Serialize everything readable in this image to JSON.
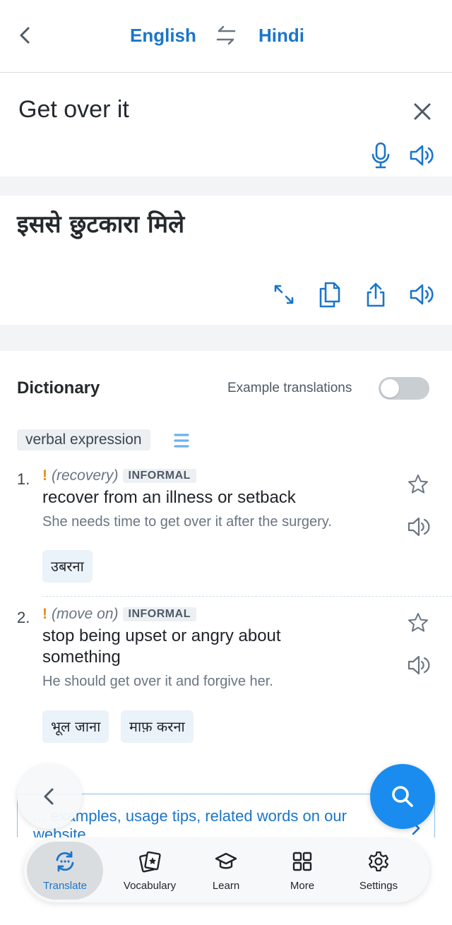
{
  "header": {
    "source_lang": "English",
    "target_lang": "Hindi",
    "icons": [
      "chevron-left-icon",
      "swap-icon"
    ]
  },
  "input": {
    "text": "Get over it",
    "icons": [
      "close-icon",
      "microphone-icon",
      "speaker-icon"
    ]
  },
  "output": {
    "text": "इससे छुटकारा मिले",
    "icons": [
      "expand-icon",
      "copy-icon",
      "share-icon",
      "speaker-icon"
    ]
  },
  "dictionary": {
    "title": "Dictionary",
    "example_translations_label": "Example translations",
    "example_translations_enabled": false,
    "part_of_speech": "verbal expression",
    "entries": [
      {
        "number": "1.",
        "marker": "!",
        "context": "(recovery)",
        "register": "INFORMAL",
        "definition": "recover from an illness or setback",
        "example": "She needs time to get over it after the surgery.",
        "translations": [
          "उबरना"
        ]
      },
      {
        "number": "2.",
        "marker": "!",
        "context": "(move on)",
        "register": "INFORMAL",
        "definition": "stop being upset or angry about something",
        "example": "He should get over it and forgive her.",
        "translations": [
          "भूल जाना",
          "माफ़ करना"
        ]
      }
    ]
  },
  "banner": {
    "text": "... examples, usage tips, related words on our website"
  },
  "nav": {
    "active": "Translate",
    "items": [
      {
        "label": "Translate",
        "icon": "translate-icon"
      },
      {
        "label": "Vocabulary",
        "icon": "vocabulary-cards-icon"
      },
      {
        "label": "Learn",
        "icon": "graduation-cap-icon"
      },
      {
        "label": "More",
        "icon": "grid-icon"
      },
      {
        "label": "Settings",
        "icon": "gear-icon"
      }
    ]
  },
  "colors": {
    "accent": "#1b75c9",
    "fab": "#1a8cf0",
    "warning": "#e88a1a"
  }
}
